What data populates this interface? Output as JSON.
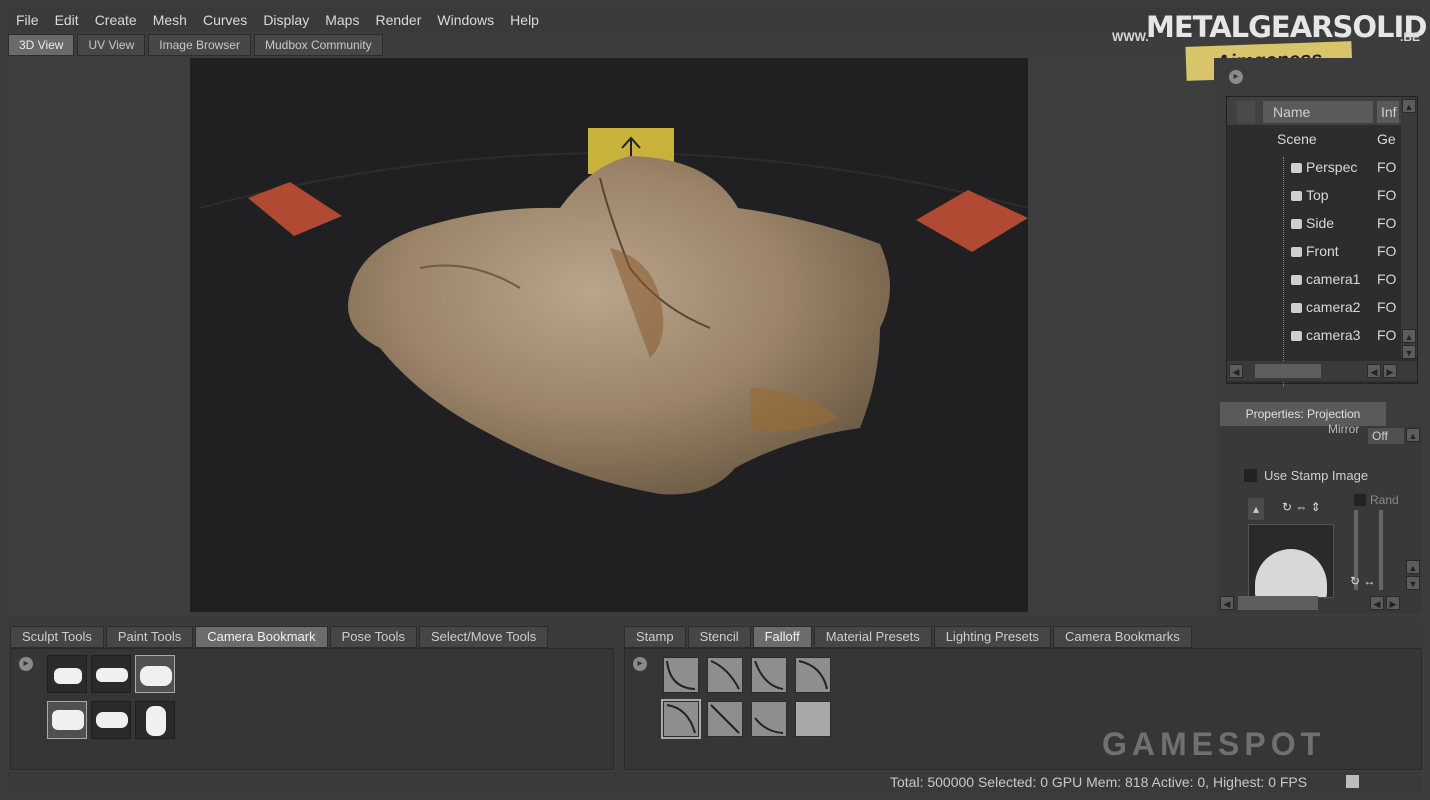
{
  "menu": [
    "File",
    "Edit",
    "Create",
    "Mesh",
    "Curves",
    "Display",
    "Maps",
    "Render",
    "Windows",
    "Help"
  ],
  "view_tabs": [
    "3D View",
    "UV View",
    "Image Browser",
    "Mudbox Community"
  ],
  "outliner": {
    "col_name": "Name",
    "col_info": "Inf",
    "rows": [
      {
        "name": "Scene",
        "type": "Ge"
      },
      {
        "name": "Perspec",
        "type": "FO"
      },
      {
        "name": "Top",
        "type": "FO"
      },
      {
        "name": "Side",
        "type": "FO"
      },
      {
        "name": "Front",
        "type": "FO"
      },
      {
        "name": "camera1",
        "type": "FO"
      },
      {
        "name": "camera2",
        "type": "FO"
      },
      {
        "name": "camera3",
        "type": "FO"
      }
    ]
  },
  "properties": {
    "tab": "Properties: Projection",
    "mirror_label": "Mirror",
    "mirror_value": "Off",
    "use_stamp_label": "Use Stamp Image",
    "random_label": "Rand"
  },
  "left_tray": {
    "tabs": [
      "Sculpt Tools",
      "Paint Tools",
      "Camera Bookmark",
      "Pose Tools",
      "Select/Move Tools"
    ],
    "active": "Camera Bookmark"
  },
  "right_tray": {
    "tabs": [
      "Stamp",
      "Stencil",
      "Falloff",
      "Material Presets",
      "Lighting Presets",
      "Camera Bookmarks"
    ],
    "active": "Falloff"
  },
  "status": {
    "text": "Total: 500000  Selected: 0 GPU Mem: 818  Active: 0, Highest: 0  FPS"
  },
  "watermark": {
    "www": "WWW.",
    "site": "METALGEARSOLID",
    "tld": ".BE",
    "sub": "Aimgeness",
    "gamespot": "GAMESPOT"
  }
}
